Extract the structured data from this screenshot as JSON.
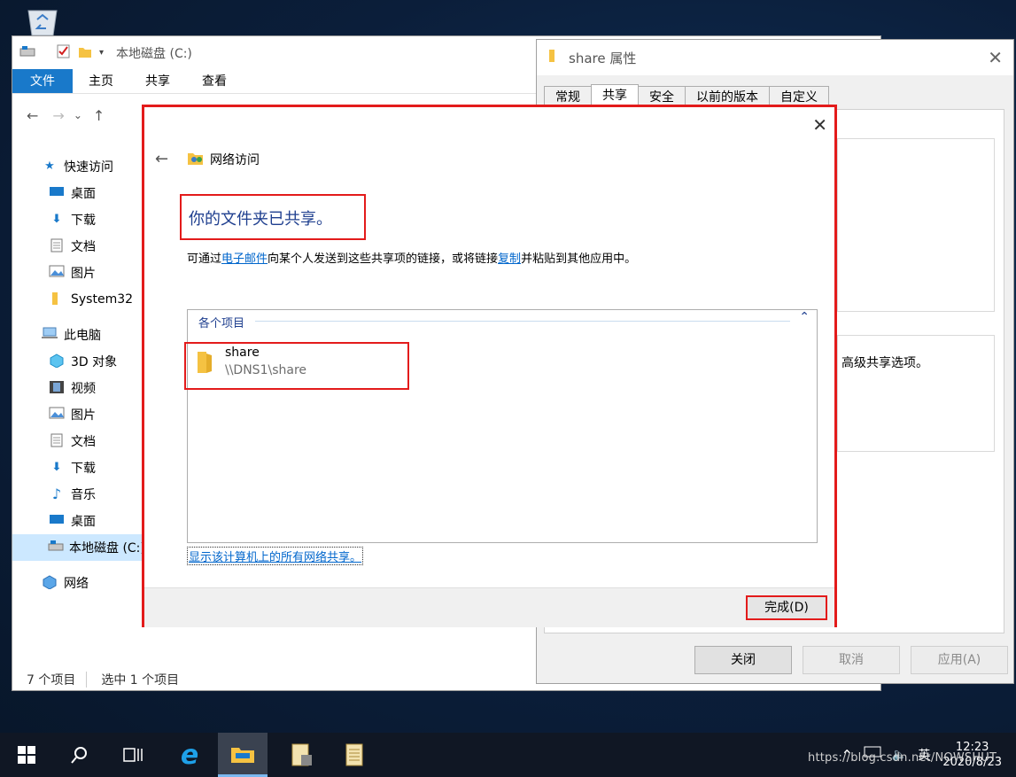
{
  "explorer": {
    "title": "本地磁盘 (C:)",
    "ribbon_tabs": [
      "文件",
      "主页",
      "共享",
      "查看"
    ],
    "nav": [
      {
        "label": "快速访问",
        "icon": "star-icon"
      },
      {
        "label": "桌面",
        "icon": "desktop-icon"
      },
      {
        "label": "下载",
        "icon": "download-icon"
      },
      {
        "label": "文档",
        "icon": "document-icon"
      },
      {
        "label": "图片",
        "icon": "picture-icon"
      },
      {
        "label": "System32",
        "icon": "folder-icon"
      },
      {
        "label": "此电脑",
        "icon": "computer-icon"
      },
      {
        "label": "3D 对象",
        "icon": "cube-icon"
      },
      {
        "label": "视频",
        "icon": "video-icon"
      },
      {
        "label": "图片",
        "icon": "picture-icon"
      },
      {
        "label": "文档",
        "icon": "document-icon"
      },
      {
        "label": "下载",
        "icon": "download-icon"
      },
      {
        "label": "音乐",
        "icon": "music-icon"
      },
      {
        "label": "桌面",
        "icon": "desktop-icon"
      },
      {
        "label": "本地磁盘 (C:)",
        "icon": "drive-icon",
        "selected": true
      },
      {
        "label": "网络",
        "icon": "network-icon"
      }
    ],
    "status_items": "7 个项目",
    "status_selected": "选中 1 个项目"
  },
  "properties": {
    "title": "share 属性",
    "tabs": [
      "常规",
      "共享",
      "安全",
      "以前的版本",
      "自定义"
    ],
    "advanced_text": "高级共享选项。",
    "buttons": [
      "关闭",
      "取消",
      "应用(A)"
    ]
  },
  "dialog": {
    "title": "网络访问",
    "heading": "你的文件夹已共享。",
    "desc_part1": "可通过",
    "desc_link1": "电子邮件",
    "desc_part2": "向某个人发送到这些共享项的链接，或将链接",
    "desc_link2": "复制",
    "desc_part3": "并粘贴到其他应用中。",
    "group_label": "各个项目",
    "item_name": "share",
    "item_path": "\\\\DNS1\\share",
    "show_all_link": "显示该计算机上的所有网络共享。",
    "done_button": "完成(D)"
  },
  "taskbar": {
    "lang": "英",
    "time": "12:23",
    "date": "2020/8/23",
    "watermark": "https://blog.csdn.net/NOWSHUT"
  },
  "colors": {
    "accent": "#1979ca",
    "highlight_red": "#e31b1b",
    "link": "#0066cc"
  }
}
